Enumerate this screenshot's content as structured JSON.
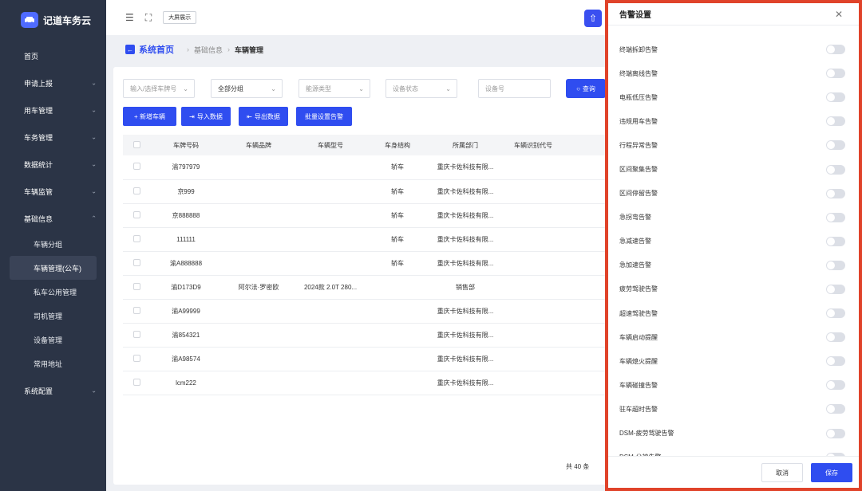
{
  "app": {
    "title": "记道车务云"
  },
  "sidebar": {
    "items": [
      {
        "label": "首页",
        "chev": ""
      },
      {
        "label": "申请上报",
        "chev": "⌄"
      },
      {
        "label": "用车管理",
        "chev": "⌄"
      },
      {
        "label": "车务管理",
        "chev": "⌄"
      },
      {
        "label": "数据统计",
        "chev": "⌄"
      },
      {
        "label": "车辆监管",
        "chev": "⌄"
      },
      {
        "label": "基础信息",
        "chev": "⌃"
      }
    ],
    "sub_items": [
      "车辆分组",
      "车辆管理(公车)",
      "私车公用管理",
      "司机管理",
      "设备管理",
      "常用地址"
    ],
    "last_item": {
      "label": "系统配置",
      "chev": "⌄"
    }
  },
  "topbar": {
    "fullscreen_label": "大屏展示"
  },
  "breadcrumb": {
    "home": "系统首页",
    "mid": "基础信息",
    "current": "车辆管理"
  },
  "filters": {
    "plate": "输入/选择车牌号",
    "group": "全部分组",
    "energy": "能源类型",
    "device_status": "设备状态",
    "device_no": "设备号",
    "search": "查询"
  },
  "actions": [
    "+ 新增车辆",
    "导入数据",
    "导出数据",
    "批量设置告警"
  ],
  "table": {
    "columns": [
      "车牌号码",
      "车辆品牌",
      "车辆型号",
      "车身结构",
      "所属部门",
      "车辆识别代号"
    ],
    "rows": [
      [
        "渝797979",
        "",
        "",
        "轿车",
        "重庆卡佐科技有限...",
        ""
      ],
      [
        "京999",
        "",
        "",
        "轿车",
        "重庆卡佐科技有限...",
        ""
      ],
      [
        "京888888",
        "",
        "",
        "轿车",
        "重庆卡佐科技有限...",
        ""
      ],
      [
        "111111",
        "",
        "",
        "轿车",
        "重庆卡佐科技有限...",
        ""
      ],
      [
        "渝A888888",
        "",
        "",
        "轿车",
        "重庆卡佐科技有限...",
        ""
      ],
      [
        "渝D173D9",
        "阿尔法·罗密欧",
        "2024款 2.0T 280...",
        "",
        "销售部",
        ""
      ],
      [
        "渝A99999",
        "",
        "",
        "",
        "重庆卡佐科技有限...",
        ""
      ],
      [
        "渝854321",
        "",
        "",
        "",
        "重庆卡佐科技有限...",
        ""
      ],
      [
        "渝A98574",
        "",
        "",
        "",
        "重庆卡佐科技有限...",
        ""
      ],
      [
        "lcm222",
        "",
        "",
        "",
        "重庆卡佐科技有限...",
        ""
      ]
    ]
  },
  "pager": {
    "total": "共 40 条"
  },
  "drawer": {
    "title": "告警设置",
    "alarms": [
      "终端拆卸告警",
      "终端离线告警",
      "电瓶低压告警",
      "违规用车告警",
      "行程异常告警",
      "区间聚集告警",
      "区间停留告警",
      "急拐弯告警",
      "急减速告警",
      "急加速告警",
      "疲劳驾驶告警",
      "超速驾驶告警",
      "车辆启动提醒",
      "车辆熄火提醒",
      "车辆碰撞告警",
      "驻车超时告警",
      "DSM-疲劳驾驶告警",
      "DSM-分神告警"
    ],
    "cancel": "取消",
    "save": "保存"
  }
}
